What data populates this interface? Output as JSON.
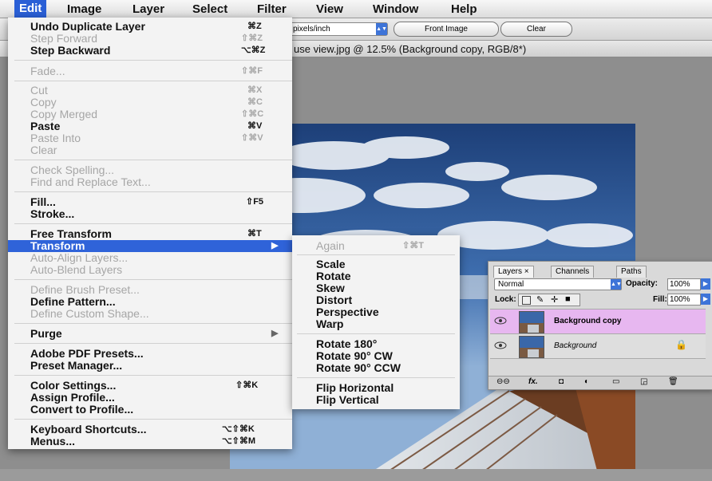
{
  "menubar": {
    "items": [
      "Edit",
      "Image",
      "Layer",
      "Select",
      "Filter",
      "View",
      "Window",
      "Help"
    ],
    "active": "Edit"
  },
  "options_bar": {
    "resolution_unit": "pixels/inch",
    "front_image_label": "Front Image",
    "clear_label": "Clear"
  },
  "document": {
    "title_fragment": "use view.jpg @ 12.5% (Background copy, RGB/8*)"
  },
  "edit_menu": {
    "items": [
      {
        "label": "Undo Duplicate Layer",
        "shortcut": "⌘Z",
        "enabled": true
      },
      {
        "label": "Step Forward",
        "shortcut": "⇧⌘Z",
        "enabled": false
      },
      {
        "label": "Step Backward",
        "shortcut": "⌥⌘Z",
        "enabled": true
      },
      {
        "label": "Fade...",
        "shortcut": "⇧⌘F",
        "enabled": false
      },
      {
        "label": "Cut",
        "shortcut": "⌘X",
        "enabled": false
      },
      {
        "label": "Copy",
        "shortcut": "⌘C",
        "enabled": false
      },
      {
        "label": "Copy Merged",
        "shortcut": "⇧⌘C",
        "enabled": false
      },
      {
        "label": "Paste",
        "shortcut": "⌘V",
        "enabled": true
      },
      {
        "label": "Paste Into",
        "shortcut": "⇧⌘V",
        "enabled": false
      },
      {
        "label": "Clear",
        "shortcut": "",
        "enabled": false
      },
      {
        "label": "Check Spelling...",
        "shortcut": "",
        "enabled": false
      },
      {
        "label": "Find and Replace Text...",
        "shortcut": "",
        "enabled": false
      },
      {
        "label": "Fill...",
        "shortcut": "⇧F5",
        "enabled": true
      },
      {
        "label": "Stroke...",
        "shortcut": "",
        "enabled": true
      },
      {
        "label": "Free Transform",
        "shortcut": "⌘T",
        "enabled": true
      },
      {
        "label": "Transform",
        "shortcut": "▶",
        "enabled": true,
        "highlighted": true
      },
      {
        "label": "Auto-Align Layers...",
        "shortcut": "",
        "enabled": false
      },
      {
        "label": "Auto-Blend Layers",
        "shortcut": "",
        "enabled": false
      },
      {
        "label": "Define Brush Preset...",
        "shortcut": "",
        "enabled": false
      },
      {
        "label": "Define Pattern...",
        "shortcut": "",
        "enabled": true
      },
      {
        "label": "Define Custom Shape...",
        "shortcut": "",
        "enabled": false
      },
      {
        "label": "Purge",
        "shortcut": "▶",
        "enabled": true
      },
      {
        "label": "Adobe PDF Presets...",
        "shortcut": "",
        "enabled": true
      },
      {
        "label": "Preset Manager...",
        "shortcut": "",
        "enabled": true
      },
      {
        "label": "Color Settings...",
        "shortcut": "⇧⌘K",
        "enabled": true
      },
      {
        "label": "Assign Profile...",
        "shortcut": "",
        "enabled": true
      },
      {
        "label": "Convert to Profile...",
        "shortcut": "",
        "enabled": true
      },
      {
        "label": "Keyboard Shortcuts...",
        "shortcut": "⌥⇧⌘K",
        "enabled": true
      },
      {
        "label": "Menus...",
        "shortcut": "⌥⇧⌘M",
        "enabled": true
      }
    ]
  },
  "transform_submenu": {
    "items": [
      {
        "label": "Again",
        "shortcut": "⇧⌘T",
        "enabled": false
      },
      {
        "label": "Scale",
        "shortcut": "",
        "enabled": true
      },
      {
        "label": "Rotate",
        "shortcut": "",
        "enabled": true
      },
      {
        "label": "Skew",
        "shortcut": "",
        "enabled": true
      },
      {
        "label": "Distort",
        "shortcut": "",
        "enabled": true
      },
      {
        "label": "Perspective",
        "shortcut": "",
        "enabled": true
      },
      {
        "label": "Warp",
        "shortcut": "",
        "enabled": true
      },
      {
        "label": "Rotate 180°",
        "shortcut": "",
        "enabled": true
      },
      {
        "label": "Rotate 90° CW",
        "shortcut": "",
        "enabled": true
      },
      {
        "label": "Rotate 90° CCW",
        "shortcut": "",
        "enabled": true
      },
      {
        "label": "Flip Horizontal",
        "shortcut": "",
        "enabled": true
      },
      {
        "label": "Flip Vertical",
        "shortcut": "",
        "enabled": true
      }
    ]
  },
  "layers_panel": {
    "tabs": [
      "Layers ×",
      "Channels",
      "Paths"
    ],
    "blend_mode": "Normal",
    "opacity_label": "Opacity:",
    "opacity_value": "100%",
    "lock_label": "Lock:",
    "fill_label": "Fill:",
    "fill_value": "100%",
    "layers": [
      {
        "name": "Background copy",
        "selected": true,
        "locked": false
      },
      {
        "name": "Background",
        "selected": false,
        "locked": true
      }
    ],
    "fx_label": "fx."
  },
  "colors": {
    "highlight": "#2f63d9",
    "selected_layer": "#e7b7f0"
  }
}
